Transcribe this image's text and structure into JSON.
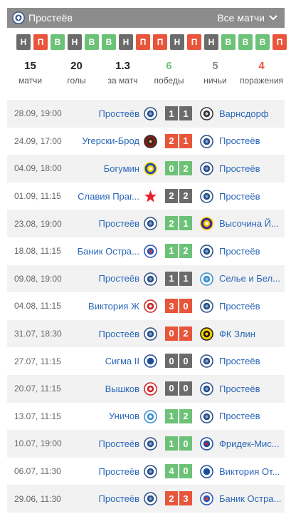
{
  "header": {
    "team": "Простеёв",
    "filter": "Все матчи"
  },
  "form": [
    "Н",
    "П",
    "В",
    "Н",
    "В",
    "В",
    "Н",
    "П",
    "П",
    "Н",
    "П",
    "Н",
    "В",
    "В",
    "В",
    "П"
  ],
  "stats": [
    {
      "value": "15",
      "label": "матчи",
      "color": "#222222"
    },
    {
      "value": "20",
      "label": "голы",
      "color": "#222222"
    },
    {
      "value": "1.3",
      "label": "за матч",
      "color": "#222222"
    },
    {
      "value": "6",
      "label": "победы",
      "color": "#6cc277"
    },
    {
      "value": "5",
      "label": "ничьи",
      "color": "#888888"
    },
    {
      "value": "4",
      "label": "поражения",
      "color": "#e8553a"
    }
  ],
  "matches": [
    {
      "date": "28.09, 19:00",
      "home": "Простеёв",
      "home_icon": "prostejov-crest",
      "hs": "1",
      "as": "1",
      "away": "Варнсдорф",
      "away_icon": "varnsdorf-crest",
      "res": "n"
    },
    {
      "date": "24.09, 17:00",
      "home": "Угерски-Брод",
      "home_icon": "uhersky-brod-crest",
      "hs": "2",
      "as": "1",
      "away": "Простеёв",
      "away_icon": "prostejov-crest",
      "res": "p"
    },
    {
      "date": "04.09, 18:00",
      "home": "Богумин",
      "home_icon": "bohumin-crest",
      "hs": "0",
      "as": "2",
      "away": "Простеёв",
      "away_icon": "prostejov-crest",
      "res": "v"
    },
    {
      "date": "01.09, 11:15",
      "home": "Славия Праг...",
      "home_icon": "slavia-star",
      "hs": "2",
      "as": "2",
      "away": "Простеёв",
      "away_icon": "prostejov-crest",
      "res": "n"
    },
    {
      "date": "23.08, 19:00",
      "home": "Простеёв",
      "home_icon": "prostejov-crest",
      "hs": "2",
      "as": "1",
      "away": "Высочина Й...",
      "away_icon": "vysocina-crest",
      "res": "v"
    },
    {
      "date": "18.08, 11:15",
      "home": "Баник Остра...",
      "home_icon": "banik-crest",
      "hs": "1",
      "as": "2",
      "away": "Простеёв",
      "away_icon": "prostejov-crest",
      "res": "v"
    },
    {
      "date": "09.08, 19:00",
      "home": "Простеёв",
      "home_icon": "prostejov-crest",
      "hs": "1",
      "as": "1",
      "away": "Селье и Бел...",
      "away_icon": "sellier-crest",
      "res": "n"
    },
    {
      "date": "04.08, 11:15",
      "home": "Виктория Ж",
      "home_icon": "viktoria-z-crest",
      "hs": "3",
      "as": "0",
      "away": "Простеёв",
      "away_icon": "prostejov-crest",
      "res": "p"
    },
    {
      "date": "31.07, 18:30",
      "home": "Простеёв",
      "home_icon": "prostejov-crest",
      "hs": "0",
      "as": "2",
      "away": "ФК Злин",
      "away_icon": "zlin-crest",
      "res": "p"
    },
    {
      "date": "27.07, 11:15",
      "home": "Сигма II",
      "home_icon": "sigma-crest",
      "hs": "0",
      "as": "0",
      "away": "Простеёв",
      "away_icon": "prostejov-crest",
      "res": "n"
    },
    {
      "date": "20.07, 11:15",
      "home": "Вышков",
      "home_icon": "vyskov-crest",
      "hs": "0",
      "as": "0",
      "away": "Простеёв",
      "away_icon": "prostejov-crest",
      "res": "n"
    },
    {
      "date": "13.07, 11:15",
      "home": "Уничов",
      "home_icon": "unicov-crest",
      "hs": "1",
      "as": "2",
      "away": "Простеёв",
      "away_icon": "prostejov-crest",
      "res": "v"
    },
    {
      "date": "10.07, 19:00",
      "home": "Простеёв",
      "home_icon": "prostejov-crest",
      "hs": "1",
      "as": "0",
      "away": "Фридек-Мис...",
      "away_icon": "fridek-crest",
      "res": "v"
    },
    {
      "date": "06.07, 11:30",
      "home": "Простеёв",
      "home_icon": "prostejov-crest",
      "hs": "4",
      "as": "0",
      "away": "Виктория От...",
      "away_icon": "viktoria-ot-crest",
      "res": "v"
    },
    {
      "date": "29.06, 11:30",
      "home": "Простеёв",
      "home_icon": "prostejov-crest",
      "hs": "2",
      "as": "3",
      "away": "Баник Остра...",
      "away_icon": "banik-crest",
      "res": "p"
    }
  ]
}
